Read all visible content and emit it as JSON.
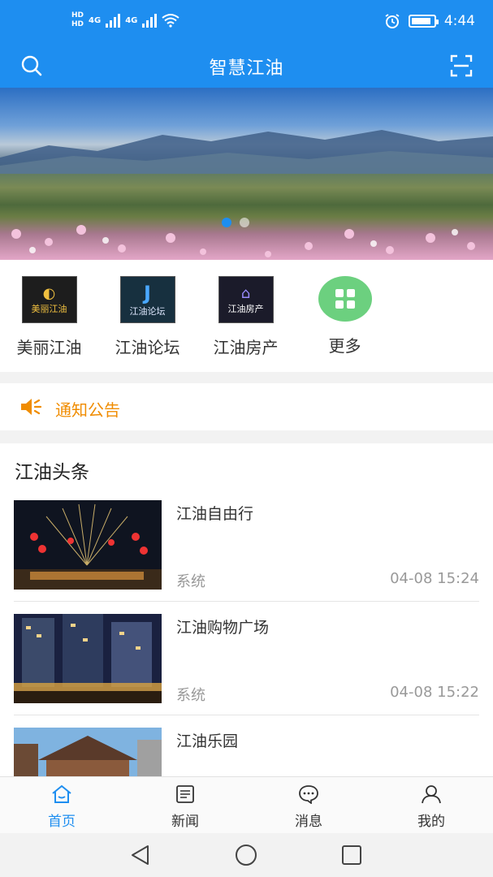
{
  "status_bar": {
    "network_left": [
      "HD",
      "HD"
    ],
    "signal_labels": [
      "4G",
      "4G"
    ],
    "time": "4:44",
    "battery_level": 0.9,
    "icons": [
      "wifi-icon",
      "alarm-icon",
      "battery-icon"
    ]
  },
  "app_bar": {
    "title": "智慧江油",
    "left_icon": "search-icon",
    "right_icon": "scan-icon"
  },
  "banner": {
    "slide_count": 2,
    "active_slide": 0,
    "accent": "#1e8ef0"
  },
  "shortcuts": [
    {
      "label": "美丽江油",
      "logo_text": "美丽江油"
    },
    {
      "label": "江油论坛",
      "logo_text": "江油论坛"
    },
    {
      "label": "江油房产",
      "logo_text": "江油房产"
    },
    {
      "label": "更多",
      "icon": "grid-icon"
    }
  ],
  "notice": {
    "label": "通知公告",
    "icon": "speaker-icon",
    "color": "#f08c00"
  },
  "news": {
    "heading": "江油头条",
    "items": [
      {
        "title": "江油自由行",
        "source": "系统",
        "time": "04-08 15:24"
      },
      {
        "title": "江油购物广场",
        "source": "系统",
        "time": "04-08 15:22"
      },
      {
        "title": "江油乐园",
        "source": "",
        "time": ""
      }
    ]
  },
  "tab_bar": {
    "tabs": [
      {
        "label": "首页",
        "icon": "home-icon",
        "active": true
      },
      {
        "label": "新闻",
        "icon": "news-icon",
        "active": false
      },
      {
        "label": "消息",
        "icon": "message-icon",
        "active": false
      },
      {
        "label": "我的",
        "icon": "profile-icon",
        "active": false
      }
    ]
  },
  "system_nav": [
    "back-icon",
    "home-circle-icon",
    "recents-icon"
  ]
}
